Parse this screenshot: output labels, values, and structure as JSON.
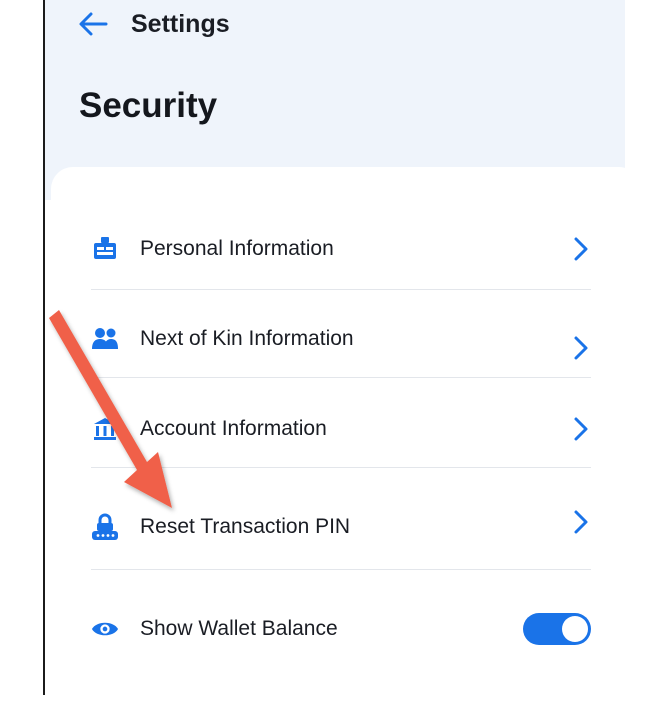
{
  "header": {
    "back_label": "Settings",
    "title": "Security"
  },
  "menu": {
    "items": [
      {
        "label": "Personal Information",
        "icon": "id-card-icon"
      },
      {
        "label": "Next of Kin Information",
        "icon": "people-icon"
      },
      {
        "label": "Account Information",
        "icon": "bank-icon"
      },
      {
        "label": "Reset Transaction PIN",
        "icon": "lock-keypad-icon"
      }
    ],
    "toggle_item": {
      "label": "Show Wallet Balance",
      "icon": "eye-icon",
      "enabled": true
    }
  },
  "colors": {
    "accent": "#1a73e8",
    "header_bg": "#eff4fb",
    "annotation_arrow": "#f0614a"
  }
}
